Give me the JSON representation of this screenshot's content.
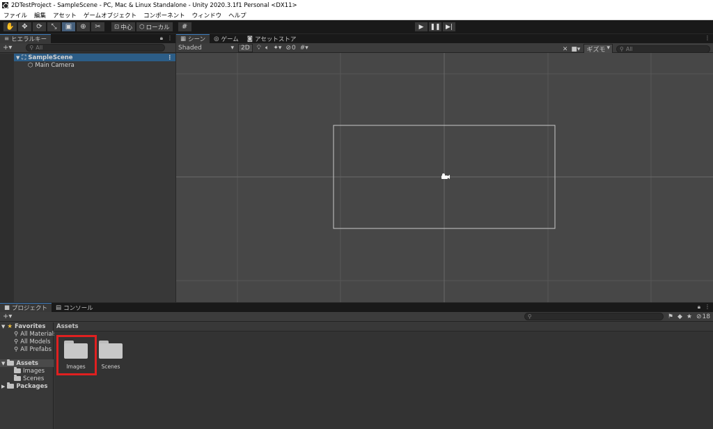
{
  "window": {
    "title": "2DTestProject - SampleScene - PC, Mac & Linux Standalone - Unity 2020.3.1f1 Personal <DX11>"
  },
  "menu": [
    "ファイル",
    "編集",
    "アセット",
    "ゲームオブジェクト",
    "コンポーネント",
    "ウィンドウ",
    "ヘルプ"
  ],
  "toolbar": {
    "pivot_label": "中心",
    "space_label": "ローカル"
  },
  "hierarchy": {
    "tab_label": "ヒエラルキー",
    "add_label": "+▾",
    "search_placeholder": "All",
    "scene_name": "SampleScene",
    "objects": [
      "Main Camera"
    ]
  },
  "scene_view": {
    "tabs": [
      "シーン",
      "ゲーム",
      "アセットストア"
    ],
    "shading_mode": "Shaded",
    "mode_2d": "2D",
    "hidden_count": "0",
    "gizmos_label": "ギズモ",
    "search_placeholder": "All"
  },
  "project": {
    "tabs": [
      "プロジェクト",
      "コンソール"
    ],
    "add_label": "+▾",
    "hidden_count": "18",
    "favorites_label": "Favorites",
    "favorites": [
      "All Materials",
      "All Models",
      "All Prefabs"
    ],
    "assets_label": "Assets",
    "asset_folders": [
      "Images",
      "Scenes"
    ],
    "packages_label": "Packages",
    "breadcrumb": "Assets",
    "grid_items": [
      "Images",
      "Scenes"
    ]
  },
  "colors": {
    "selection_highlight": "#e02020",
    "scene_selection": "#2c5d87",
    "active_tool": "#46607c"
  }
}
